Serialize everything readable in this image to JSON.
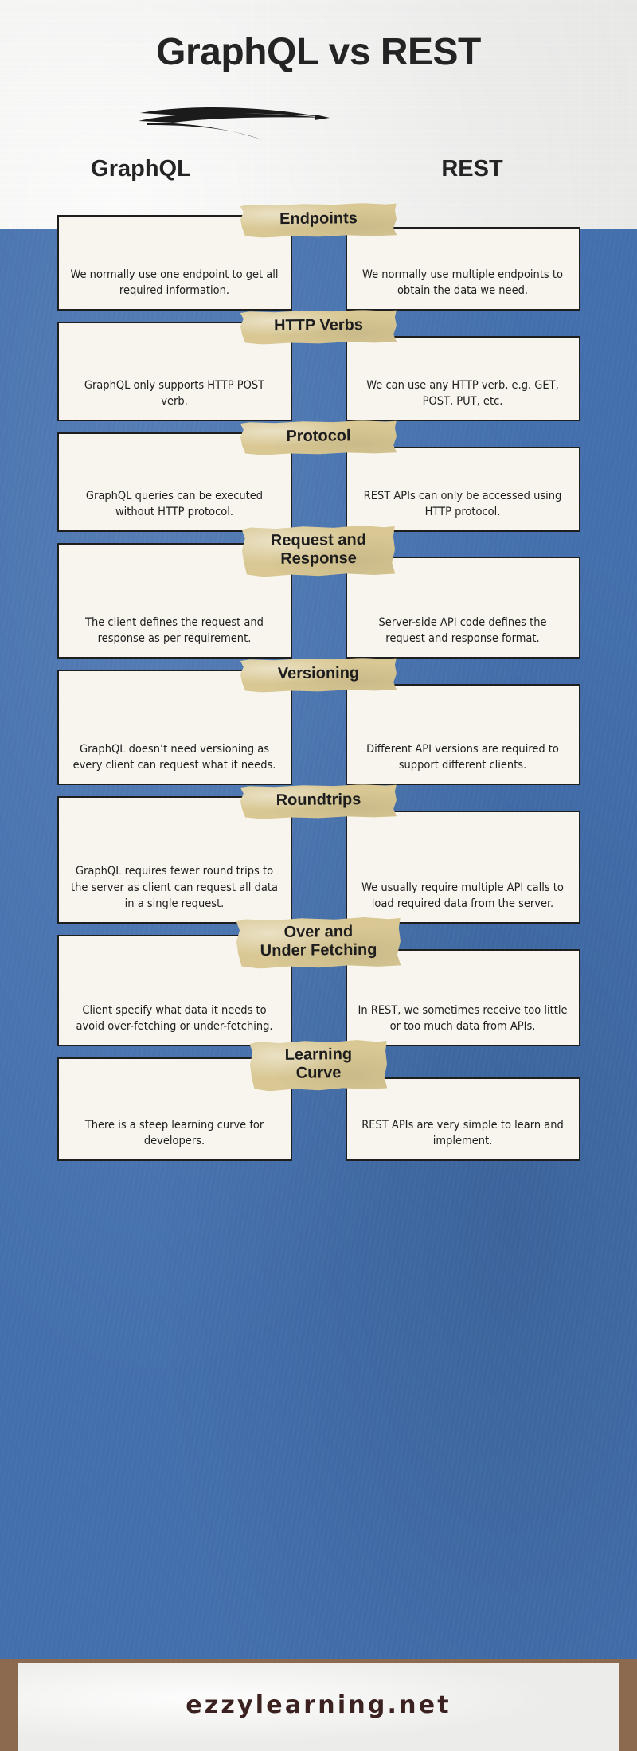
{
  "header": {
    "title": "GraphQL vs REST",
    "underline_icon": "brush-underline-swash-icon",
    "columns": {
      "left": "GraphQL",
      "right": "REST"
    }
  },
  "colors": {
    "paper": "#ececea",
    "band_blue": "#4470ae",
    "card_cream": "#f8f5ee",
    "tape_tan": "#d9c894",
    "ink": "#1e1e1e",
    "footer_text": "#3b2220"
  },
  "comparison_rows": [
    {
      "label": "Endpoints",
      "graphql": "We normally use one endpoint to get all required information.",
      "rest": "We normally use multiple endpoints to obtain the data we need."
    },
    {
      "label": "HTTP Verbs",
      "graphql": "GraphQL only supports HTTP POST verb.",
      "rest": "We can use any HTTP verb, e.g. GET, POST, PUT, etc."
    },
    {
      "label": "Protocol",
      "graphql": "GraphQL queries can be executed without HTTP protocol.",
      "rest": "REST APIs can only be accessed using HTTP protocol."
    },
    {
      "label": "Request and Response",
      "graphql": "The client defines the request and response as per requirement.",
      "rest": "Server-side API code defines the request and response format."
    },
    {
      "label": "Versioning",
      "graphql": "GraphQL doesn’t need versioning as every client can request what it needs.",
      "rest": "Different API versions are required to support different clients."
    },
    {
      "label": "Roundtrips",
      "graphql": "GraphQL requires fewer round trips to the server as client can request all data in a single request.",
      "rest": "We usually require multiple API calls to load required data from the server."
    },
    {
      "label": "Over and Under Fetching",
      "graphql": "Client specify what data it needs to avoid over-fetching or under-fetching.",
      "rest": "In REST, we sometimes receive too little or too much data from APIs."
    },
    {
      "label": "Learning Curve",
      "graphql": "There is a steep learning curve for developers.",
      "rest": "REST APIs are very simple to learn and implement."
    }
  ],
  "footer": {
    "site": "ezzylearning.net"
  }
}
